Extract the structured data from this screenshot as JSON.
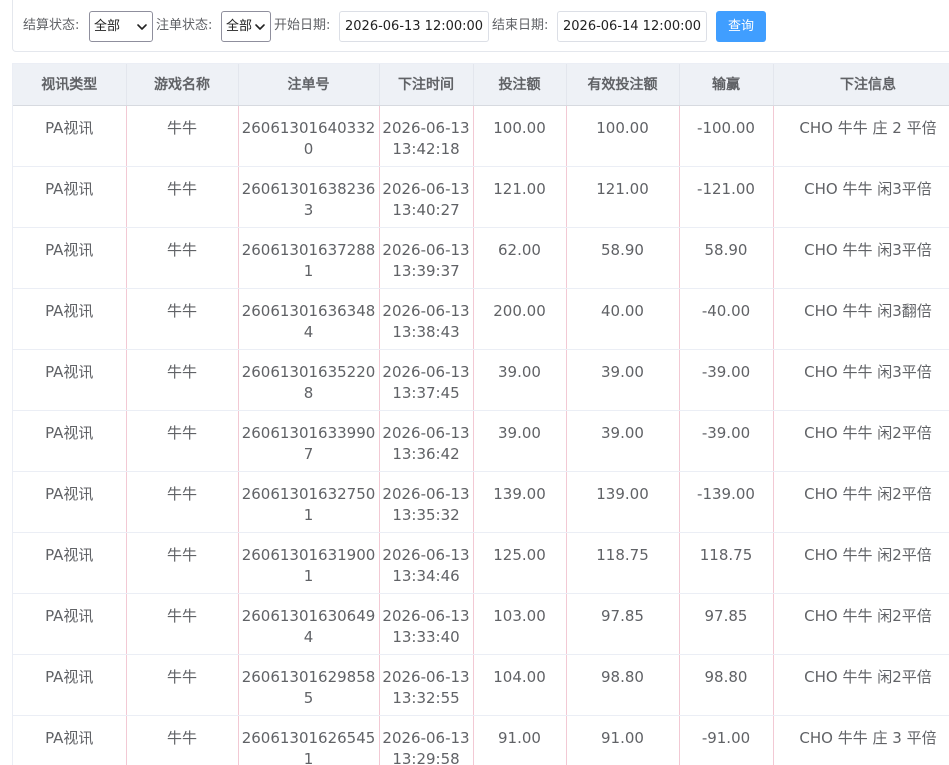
{
  "filters": {
    "settle_status": {
      "label": "结算状态:",
      "value": "全部"
    },
    "order_status": {
      "label": "注单状态:",
      "value": "全部"
    },
    "start_date": {
      "label": "开始日期:",
      "value": "2026-06-13 12:00:00"
    },
    "end_date": {
      "label": "结束日期:",
      "value": "2026-06-14 12:00:00"
    },
    "query_button": "查询"
  },
  "table": {
    "headers": [
      "视讯类型",
      "游戏名称",
      "注单号",
      "下注时间",
      "投注额",
      "有效投注额",
      "输赢",
      "下注信息"
    ],
    "rows": [
      {
        "type": "PA视讯",
        "game": "牛牛",
        "order_no": "260613016403320",
        "bet_date": "2026-06-13",
        "bet_clock": "13:42:18",
        "amount": "100.00",
        "valid_amount": "100.00",
        "win_loss": "-100.00",
        "info": "CHO 牛牛 庄 2 平倍"
      },
      {
        "type": "PA视讯",
        "game": "牛牛",
        "order_no": "260613016382363",
        "bet_date": "2026-06-13",
        "bet_clock": "13:40:27",
        "amount": "121.00",
        "valid_amount": "121.00",
        "win_loss": "-121.00",
        "info": "CHO 牛牛 闲3平倍"
      },
      {
        "type": "PA视讯",
        "game": "牛牛",
        "order_no": "260613016372881",
        "bet_date": "2026-06-13",
        "bet_clock": "13:39:37",
        "amount": "62.00",
        "valid_amount": "58.90",
        "win_loss": "58.90",
        "info": "CHO 牛牛 闲3平倍"
      },
      {
        "type": "PA视讯",
        "game": "牛牛",
        "order_no": "260613016363484",
        "bet_date": "2026-06-13",
        "bet_clock": "13:38:43",
        "amount": "200.00",
        "valid_amount": "40.00",
        "win_loss": "-40.00",
        "info": "CHO 牛牛 闲3翻倍"
      },
      {
        "type": "PA视讯",
        "game": "牛牛",
        "order_no": "260613016352208",
        "bet_date": "2026-06-13",
        "bet_clock": "13:37:45",
        "amount": "39.00",
        "valid_amount": "39.00",
        "win_loss": "-39.00",
        "info": "CHO 牛牛 闲3平倍"
      },
      {
        "type": "PA视讯",
        "game": "牛牛",
        "order_no": "260613016339907",
        "bet_date": "2026-06-13",
        "bet_clock": "13:36:42",
        "amount": "39.00",
        "valid_amount": "39.00",
        "win_loss": "-39.00",
        "info": "CHO 牛牛 闲2平倍"
      },
      {
        "type": "PA视讯",
        "game": "牛牛",
        "order_no": "260613016327501",
        "bet_date": "2026-06-13",
        "bet_clock": "13:35:32",
        "amount": "139.00",
        "valid_amount": "139.00",
        "win_loss": "-139.00",
        "info": "CHO 牛牛 闲2平倍"
      },
      {
        "type": "PA视讯",
        "game": "牛牛",
        "order_no": "260613016319001",
        "bet_date": "2026-06-13",
        "bet_clock": "13:34:46",
        "amount": "125.00",
        "valid_amount": "118.75",
        "win_loss": "118.75",
        "info": "CHO 牛牛 闲2平倍"
      },
      {
        "type": "PA视讯",
        "game": "牛牛",
        "order_no": "260613016306494",
        "bet_date": "2026-06-13",
        "bet_clock": "13:33:40",
        "amount": "103.00",
        "valid_amount": "97.85",
        "win_loss": "97.85",
        "info": "CHO 牛牛 闲2平倍"
      },
      {
        "type": "PA视讯",
        "game": "牛牛",
        "order_no": "260613016298585",
        "bet_date": "2026-06-13",
        "bet_clock": "13:32:55",
        "amount": "104.00",
        "valid_amount": "98.80",
        "win_loss": "98.80",
        "info": "CHO 牛牛 闲2平倍"
      },
      {
        "type": "PA视讯",
        "game": "牛牛",
        "order_no": "260613016265451",
        "bet_date": "2026-06-13",
        "bet_clock": "13:29:58",
        "amount": "91.00",
        "valid_amount": "91.00",
        "win_loss": "-91.00",
        "info": "CHO 牛牛 庄 3 平倍"
      }
    ]
  },
  "icons": {
    "select_arrow": "chevron-down-icon"
  },
  "colors": {
    "primary": "#409eff",
    "header_bg": "#eef1f6",
    "text": "#606266",
    "column_divider": "#f2c9d4"
  }
}
